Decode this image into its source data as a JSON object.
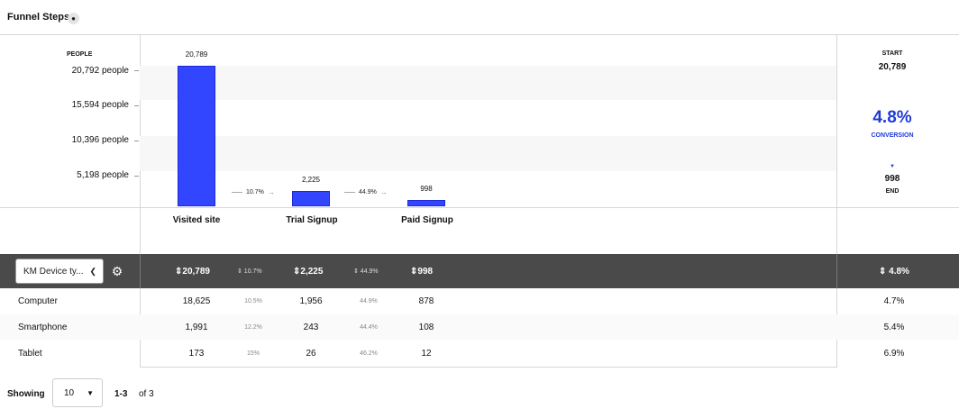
{
  "header": {
    "title": "Funnel Steps",
    "icon": "user-icon"
  },
  "chart_data": {
    "type": "bar",
    "ylabel": "PEOPLE",
    "y_ticks": [
      "20,792 people",
      "15,594 people",
      "10,396 people",
      "5,198 people"
    ],
    "categories": [
      "Visited site",
      "Trial Signup",
      "Paid Signup"
    ],
    "values": [
      20789,
      2225,
      998
    ],
    "value_labels": [
      "20,789",
      "2,225",
      "998"
    ],
    "ylim": [
      0,
      20792
    ],
    "step_conversions": [
      "10.7%",
      "44.9%"
    ],
    "bar_color": "#3346ff"
  },
  "summary": {
    "start_label": "START",
    "start_value": "20,789",
    "conversion_value": "4.8%",
    "conversion_label": "CONVERSION",
    "end_arrow": "▼",
    "end_value": "998",
    "end_label": "END",
    "accent_color": "#1f3ad6"
  },
  "breakdown": {
    "select_value": "KM Device ty...",
    "totals": {
      "step1": "⇕20,789",
      "conv1": "⇕ 10.7%",
      "step2": "⇕2,225",
      "conv2": "⇕ 44.9%",
      "step3": "⇕998",
      "overall": "⇕ 4.8%"
    },
    "rows": [
      {
        "label": "Computer",
        "s1": "18,625",
        "c1": "10.5%",
        "s2": "1,956",
        "c2": "44.9%",
        "s3": "878",
        "overall": "4.7%"
      },
      {
        "label": "Smartphone",
        "s1": "1,991",
        "c1": "12.2%",
        "s2": "243",
        "c2": "44.4%",
        "s3": "108",
        "overall": "5.4%"
      },
      {
        "label": "Tablet",
        "s1": "173",
        "c1": "15%",
        "s2": "26",
        "c2": "46.2%",
        "s3": "12",
        "overall": "6.9%"
      }
    ]
  },
  "pagination": {
    "showing_label": "Showing",
    "page_size": "10",
    "range": "1-3",
    "of_label": "of 3"
  }
}
